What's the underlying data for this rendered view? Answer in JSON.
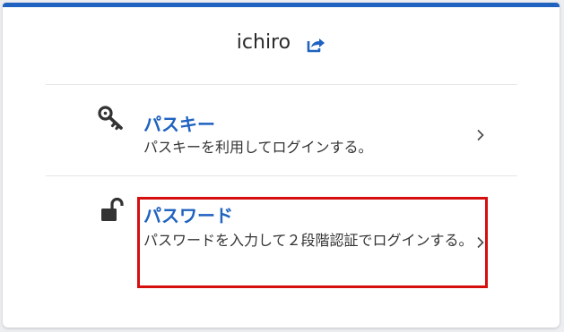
{
  "header": {
    "username": "ichiro",
    "switch_icon": "share-external-icon"
  },
  "options": [
    {
      "icon": "key-icon",
      "title": "パスキー",
      "description": "パスキーを利用してログインする。"
    },
    {
      "icon": "unlocked-padlock-icon",
      "title": "パスワード",
      "description": "パスワードを入力して２段階認証でログインする。"
    }
  ],
  "colors": {
    "accent": "#1f62c0",
    "highlight": "#d50e0e"
  }
}
